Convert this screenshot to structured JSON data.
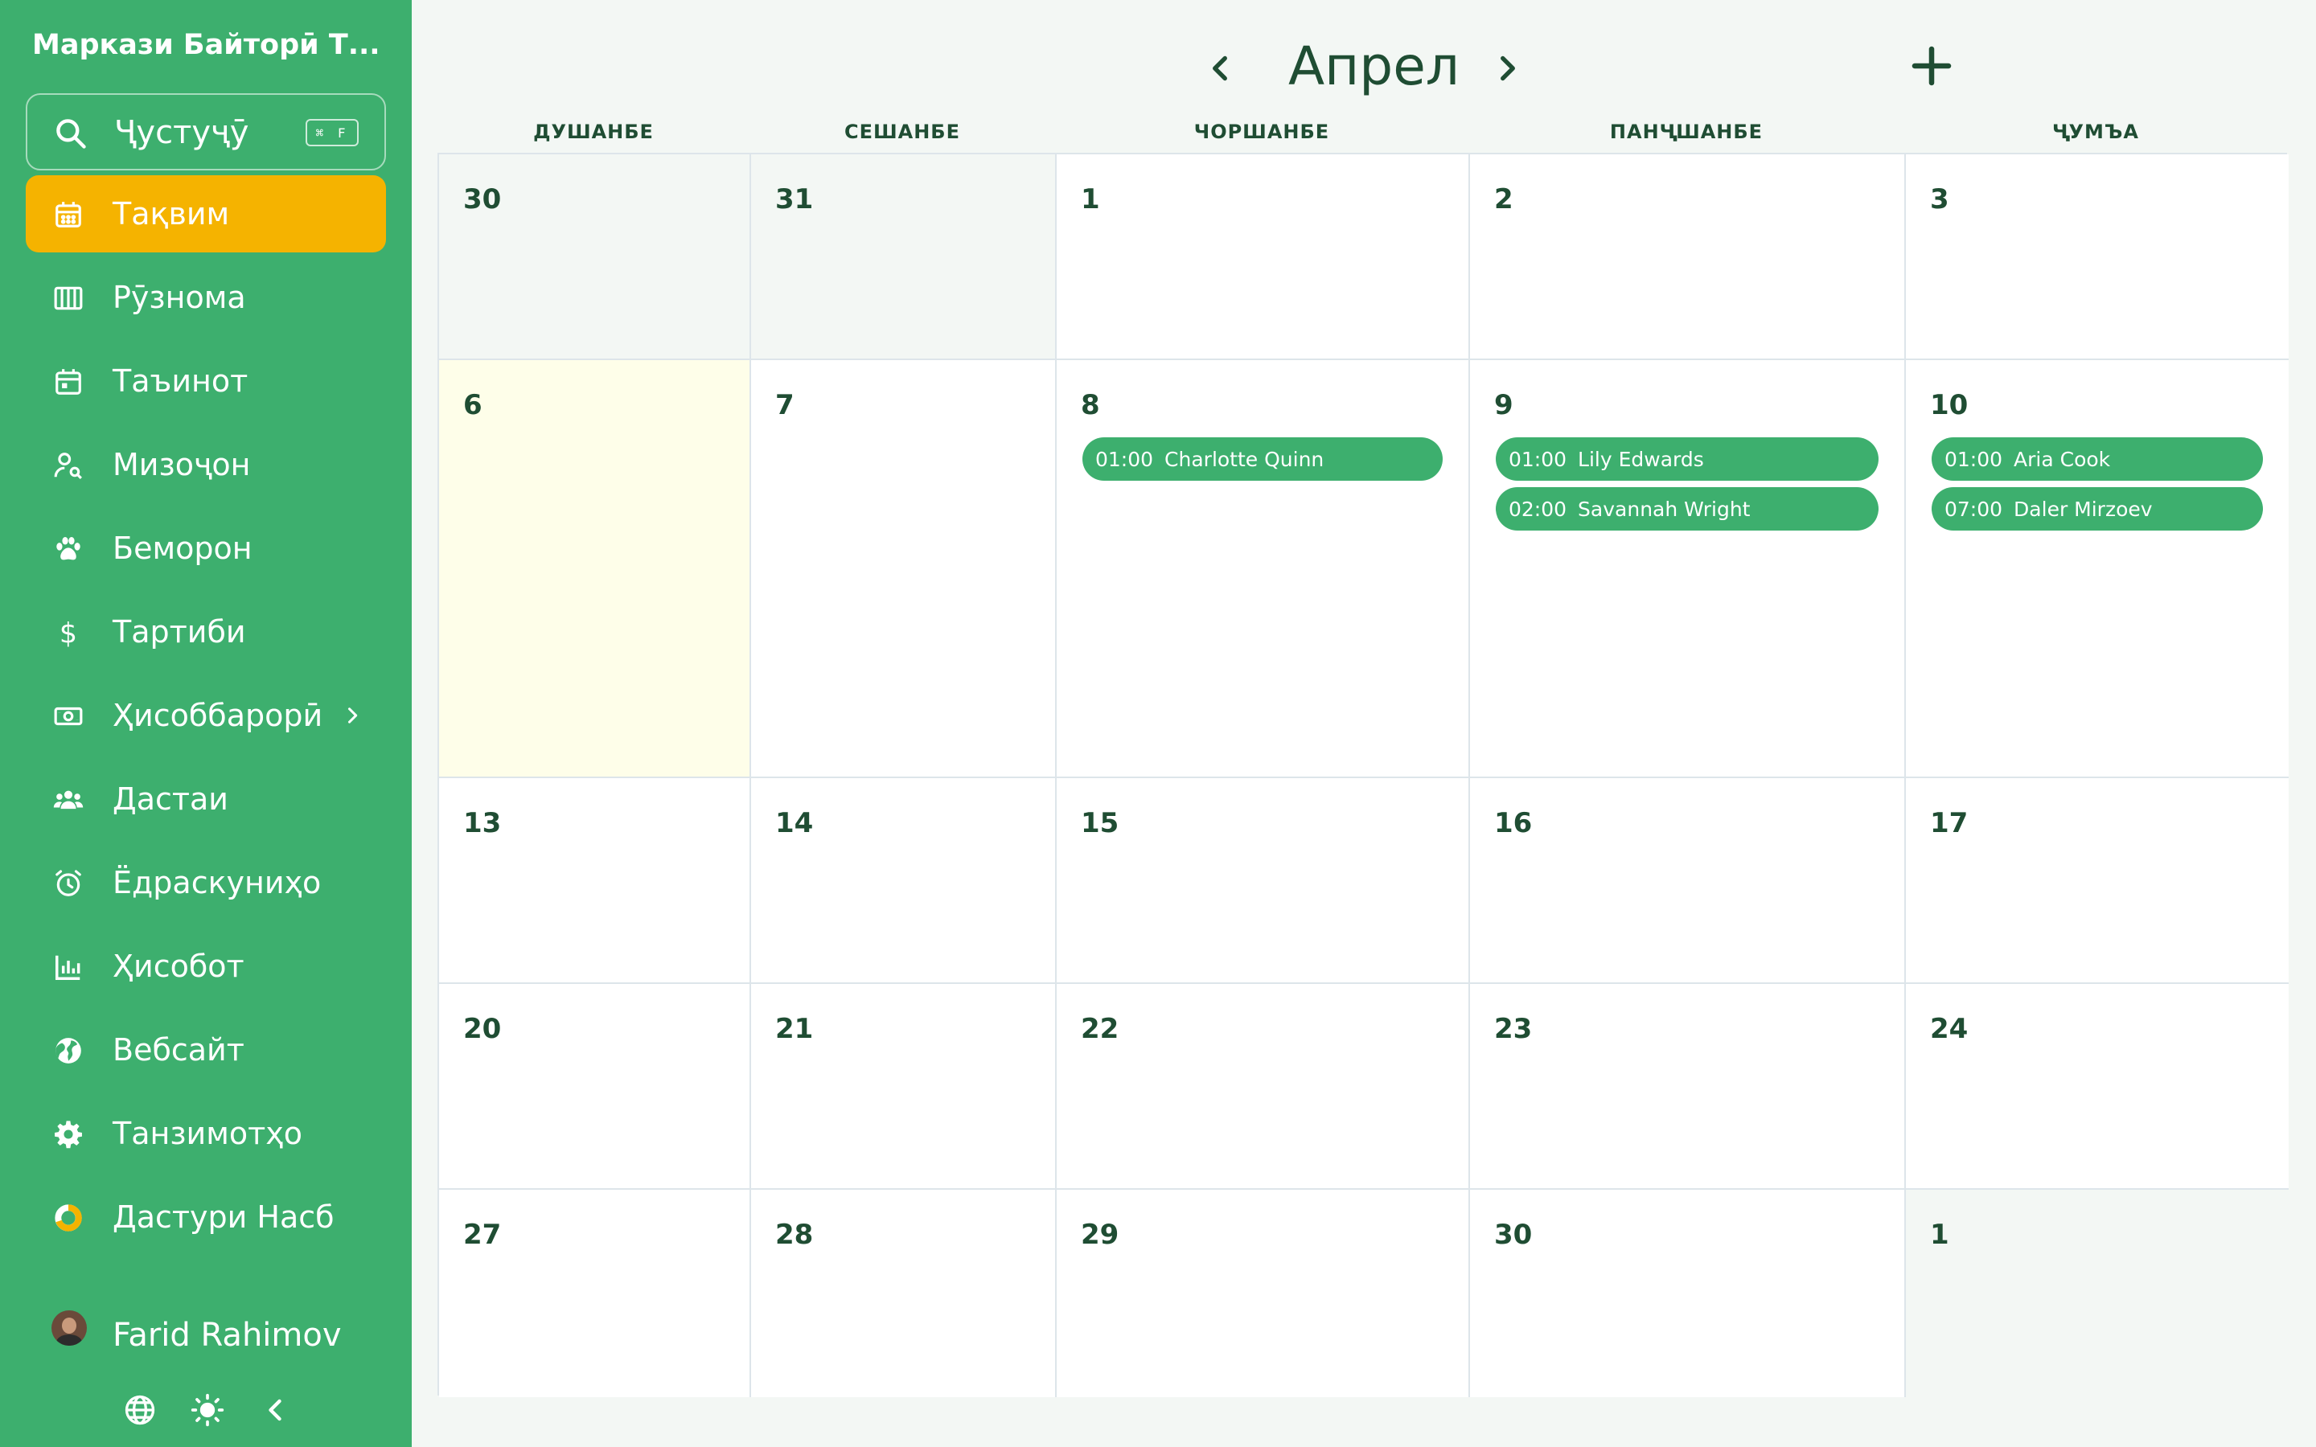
{
  "sidebar": {
    "brand": "Маркази Байторӣ Т...",
    "search": {
      "label": "Ҷустуҷӯ",
      "shortcut": "⌘ F"
    },
    "items": [
      {
        "label": "Тақвим",
        "icon": "calendar-icon",
        "active": true
      },
      {
        "label": "Рӯзнома",
        "icon": "columns-icon"
      },
      {
        "label": "Таъинот",
        "icon": "calendar-event-icon"
      },
      {
        "label": "Мизоҷон",
        "icon": "user-search-icon"
      },
      {
        "label": "Беморон",
        "icon": "paw-icon"
      },
      {
        "label": "Тартиби",
        "icon": "dollar-icon"
      },
      {
        "label": "Ҳисоббарорӣ",
        "icon": "cash-icon"
      },
      {
        "label": "Дастаи",
        "icon": "team-icon"
      },
      {
        "label": "Ёдраскуниҳо",
        "icon": "alarm-icon"
      },
      {
        "label": "Ҳисобот",
        "icon": "chart-icon"
      },
      {
        "label": "Вебсайт",
        "icon": "globe-icon"
      },
      {
        "label": "Танзимотҳо",
        "icon": "gear-icon"
      },
      {
        "label": "Дастури Насб",
        "icon": "progress-ring-icon"
      }
    ],
    "user": {
      "name": "Farid Rahimov"
    }
  },
  "calendar": {
    "month": "Апрел",
    "weekdays": [
      "ДУШАНБЕ",
      "СЕШАНБЕ",
      "ЧОРШАНБЕ",
      "ПАНҶШАНБЕ",
      "ҶУМЪА"
    ],
    "weeks": [
      [
        {
          "day": "30",
          "muted": true
        },
        {
          "day": "31",
          "muted": true
        },
        {
          "day": "1"
        },
        {
          "day": "2"
        },
        {
          "day": "3"
        }
      ],
      [
        {
          "day": "6",
          "today": true
        },
        {
          "day": "7"
        },
        {
          "day": "8",
          "events": [
            {
              "time": "01:00",
              "name": "Charlotte Quinn"
            }
          ]
        },
        {
          "day": "9",
          "events": [
            {
              "time": "01:00",
              "name": "Lily Edwards"
            },
            {
              "time": "02:00",
              "name": "Savannah Wright"
            }
          ]
        },
        {
          "day": "10",
          "events": [
            {
              "time": "01:00",
              "name": "Aria Cook"
            },
            {
              "time": "07:00",
              "name": "Daler Mirzoev"
            }
          ]
        }
      ],
      [
        {
          "day": "13"
        },
        {
          "day": "14"
        },
        {
          "day": "15"
        },
        {
          "day": "16"
        },
        {
          "day": "17"
        }
      ],
      [
        {
          "day": "20"
        },
        {
          "day": "21"
        },
        {
          "day": "22"
        },
        {
          "day": "23"
        },
        {
          "day": "24"
        }
      ],
      [
        {
          "day": "27"
        },
        {
          "day": "28"
        },
        {
          "day": "29"
        },
        {
          "day": "30"
        },
        {
          "day": "1",
          "muted": true
        }
      ]
    ]
  },
  "colors": {
    "primary": "#3daf6e",
    "active": "#f5b300",
    "today": "#fefee9",
    "text": "#1f4d33"
  }
}
